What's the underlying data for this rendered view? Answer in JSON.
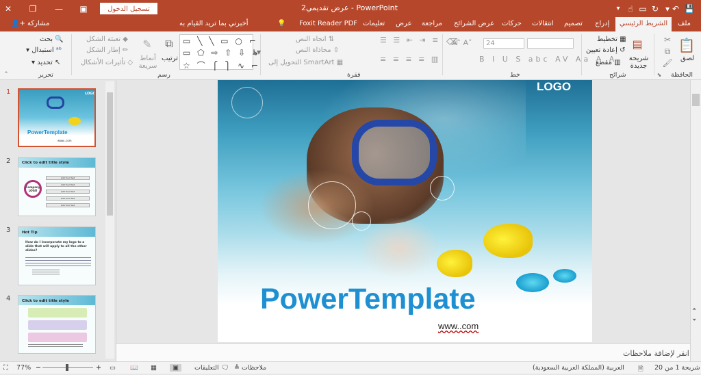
{
  "window": {
    "title": "عرض تقديمي2 - PowerPoint",
    "signin_label": "تسجيل الدخول",
    "share_label": "مشاركة"
  },
  "tabs": [
    {
      "label": "ملف"
    },
    {
      "label": "الشريط الرئيسي",
      "active": true
    },
    {
      "label": "إدراج"
    },
    {
      "label": "تصميم"
    },
    {
      "label": "انتقالات"
    },
    {
      "label": "حركات"
    },
    {
      "label": "عرض الشرائح"
    },
    {
      "label": "مراجعة"
    },
    {
      "label": "عرض"
    },
    {
      "label": "تعليمات"
    },
    {
      "label": "Foxit Reader PDF"
    }
  ],
  "tell_me": "أخبرني بما تريد القيام به",
  "ribbon": {
    "paste_label": "لصق",
    "new_slide_label": "شريحة جديدة",
    "layout_label": "تخطيط",
    "reset_label": "إعادة تعيين",
    "section_label": "مقطع",
    "font_size": "24",
    "text_direction": "اتجاه النص",
    "align_text": "محاذاة النص",
    "convert_smartart": "التحويل إلى SmartArt",
    "arrange_label": "ترتيب",
    "quick_styles_label": "أنماط سريعة",
    "shape_fill": "تعبئة الشكل",
    "shape_outline": "إطار الشكل",
    "shape_effects": "تأثيرات الأشكال",
    "find_label": "بحث",
    "replace_label": "استبدال",
    "select_label": "تحديد",
    "groups": {
      "clipboard": "الحافظة",
      "slides": "شرائح",
      "font": "خط",
      "paragraph": "فقرة",
      "drawing": "رسم",
      "editing": "تحرير"
    }
  },
  "thumbnails": [
    {
      "num": "1",
      "title": "PowerTemplate",
      "logo": "LOGO",
      "url": "www..com"
    },
    {
      "num": "2",
      "title": "Click to edit title style",
      "center": "Company LOGO",
      "item": "Add Your Text"
    },
    {
      "num": "3",
      "title": "Hot Tip",
      "body": "How do I incorporate my logo to a slide that will apply to all the other slides?"
    },
    {
      "num": "4",
      "title": "Click to edit title style"
    }
  ],
  "slide": {
    "logo": "LOGO",
    "title": "PowerTemplate",
    "url": "www..com"
  },
  "notes_placeholder": "انقر لإضافة ملاحظات",
  "status": {
    "slide_info": "شريحة 1 من 20",
    "language": "العربية (المملكة العربية السعودية)",
    "notes_btn": "ملاحظات",
    "comments_btn": "التعليقات",
    "zoom": "77%"
  },
  "colors": {
    "accent": "#b7472a",
    "slide_title": "#1e8fd0"
  }
}
